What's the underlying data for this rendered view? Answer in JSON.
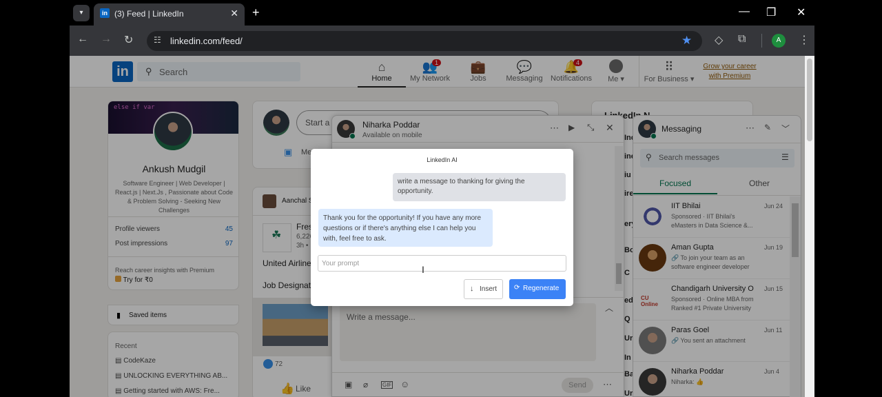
{
  "browser": {
    "tab_title": "(3) Feed | LinkedIn",
    "tab_icon_label": "in",
    "url": "linkedin.com/feed/",
    "profile_initial": "A"
  },
  "nav": {
    "logo": "in",
    "search_placeholder": "Search",
    "items": [
      {
        "label": "Home",
        "icon": "home-icon",
        "glyph": "⌂"
      },
      {
        "label": "My Network",
        "icon": "network-icon",
        "glyph": "👥",
        "badge": "1"
      },
      {
        "label": "Jobs",
        "icon": "briefcase-icon",
        "glyph": "💼"
      },
      {
        "label": "Messaging",
        "icon": "chat-icon",
        "glyph": "💬"
      },
      {
        "label": "Notifications",
        "icon": "bell-icon",
        "glyph": "🔔",
        "badge": "4"
      },
      {
        "label": "Me ▾",
        "icon": "avatar-icon",
        "glyph": "●"
      }
    ],
    "for_business": "For Business ▾",
    "premium_line1": "Grow your career",
    "premium_line2": "with Premium"
  },
  "profile": {
    "name": "Ankush Mudgil",
    "headline": "Software Engineer | Web Developer | React.js | Next.Js , Passionate about Code & Problem Solving - Seeking New Challenges",
    "viewers_label": "Profile viewers",
    "viewers_value": "45",
    "impressions_label": "Post impressions",
    "impressions_value": "97",
    "premium_text": "Reach career insights with Premium",
    "premium_cta": "Try for ₹0",
    "saved_items": "Saved items",
    "recent_label": "Recent",
    "recent": [
      "CodeKaze",
      "UNLOCKING EVERYTHING AB...",
      "Getting started with AWS: Fre..."
    ]
  },
  "feed": {
    "start_post": "Start a",
    "media": "Me",
    "poster": "Aanchal S",
    "company_name": "Fres",
    "company_meta1": "6,226",
    "company_meta2": "3h •",
    "text1": "United Airline",
    "text2": "Job Designati",
    "reactions": "72",
    "like": "Like"
  },
  "news": {
    "title": "LinkedIn N",
    "partial_lines": [
      "Inc",
      "ine",
      "iu",
      "ire",
      "ery",
      "Bo",
      "C",
      "edi",
      "Q",
      "Ur",
      "In",
      "Ba",
      "Ur"
    ]
  },
  "chat": {
    "name": "Niharka Poddar",
    "status": "Available on mobile",
    "write_placeholder": "Write a message...",
    "send": "Send",
    "toolbar": [
      "image-icon",
      "attach-icon",
      "gif-icon",
      "emoji-icon"
    ]
  },
  "ai_modal": {
    "title": "LinkedIn AI",
    "user_message": "write a message to thanking for giving the opportunity.",
    "ai_message": "Thank you for the opportunity! If you have any more questions or if there's anything else I can help you with, feel free to ask.",
    "prompt_placeholder": "Your prompt",
    "insert": "Insert",
    "regenerate": "Regenerate"
  },
  "messaging": {
    "title": "Messaging",
    "search_placeholder": "Search messages",
    "tab_focused": "Focused",
    "tab_other": "Other",
    "conversations": [
      {
        "name": "IIT Bhilai",
        "date": "Jun 24",
        "line1": "Sponsored · IIT Bhilai's",
        "line2": "eMasters in Data Science &..."
      },
      {
        "name": "Aman Gupta",
        "date": "Jun 19",
        "line1": "🔗 To join your team as an",
        "line2": "software engineer developer"
      },
      {
        "name": "Chandigarh University O",
        "date": "Jun 15",
        "line1": "Sponsored · Online MBA from",
        "line2": "Ranked #1 Private University"
      },
      {
        "name": "Paras Goel",
        "date": "Jun 11",
        "line1": "🔗 You sent an attachment",
        "line2": ""
      },
      {
        "name": "Niharka Poddar",
        "date": "Jun 4",
        "line1": "Niharka: 👍",
        "line2": ""
      }
    ]
  },
  "colors": {
    "linkedin_blue": "#0a66c2",
    "focused_green": "#01754f",
    "page_bg": "#f3f2ef"
  }
}
